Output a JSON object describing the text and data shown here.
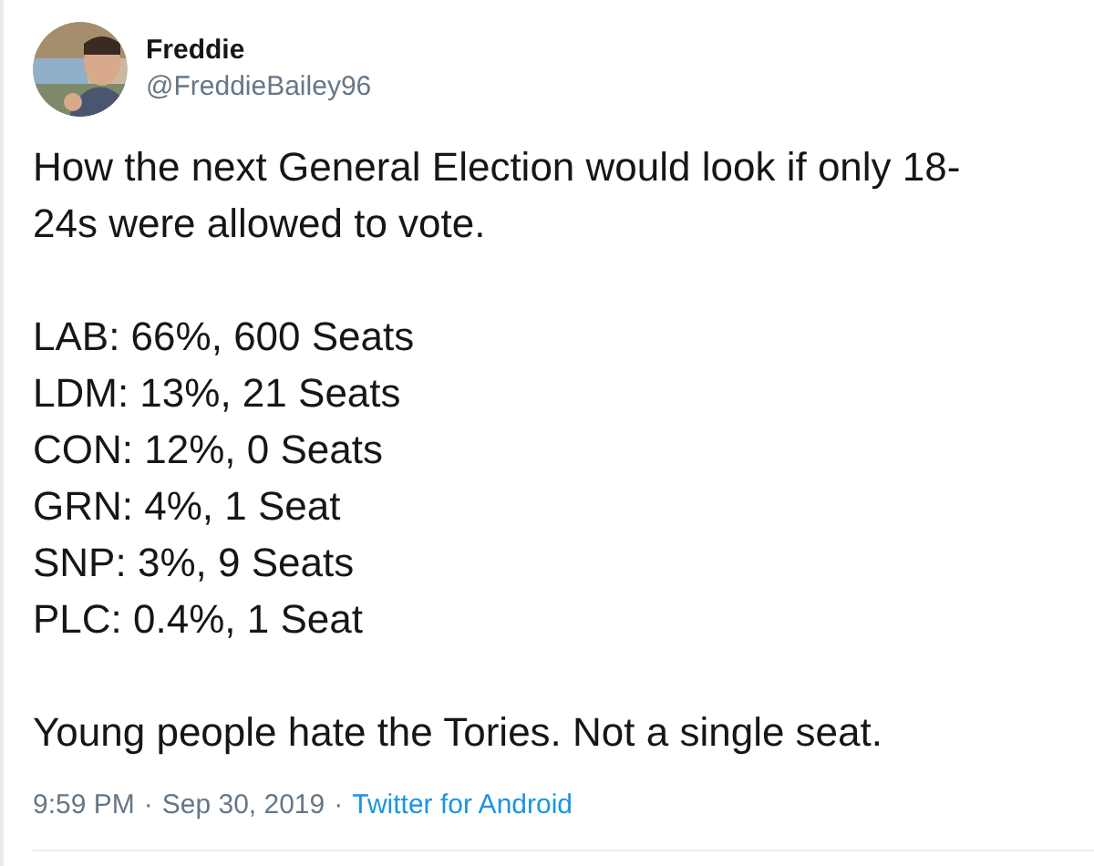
{
  "author": {
    "name": "Freddie",
    "handle": "@FreddieBailey96"
  },
  "tweet": {
    "intro": "How the next General Election would look if only 18-24s were allowed to vote.",
    "results": [
      "LAB: 66%, 600 Seats",
      "LDM: 13%, 21 Seats",
      "CON: 12%, 0 Seats",
      "GRN: 4%, 1 Seat",
      "SNP: 3%, 9 Seats",
      "PLC: 0.4%, 1 Seat"
    ],
    "closing": "Young people hate the Tories. Not a single seat."
  },
  "footer": {
    "time": "9:59 PM",
    "separator": "·",
    "date": "Sep 30, 2019",
    "source": "Twitter for Android"
  }
}
